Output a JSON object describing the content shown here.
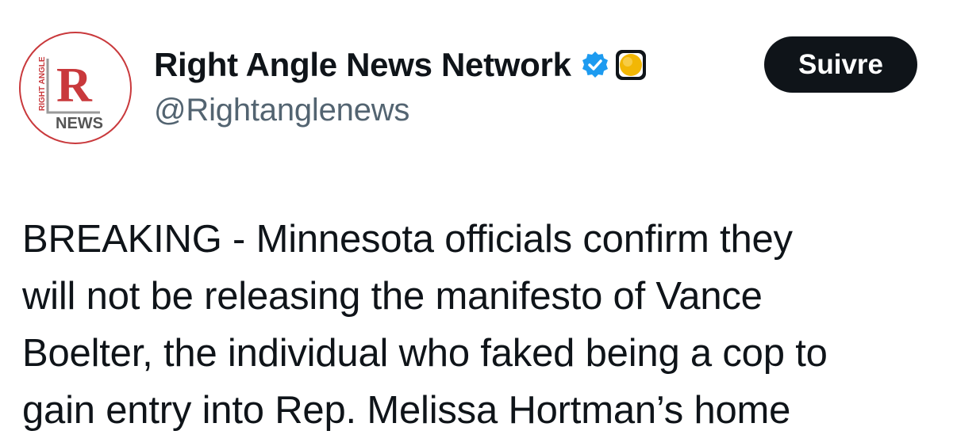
{
  "account": {
    "display_name": "Right Angle News Network",
    "handle": "@Rightanglenews",
    "avatar": {
      "logo_texts": [
        "RIGHT ANGLE",
        "R",
        "NEWS"
      ],
      "logo_color": "#c9393c"
    },
    "verified_badge": {
      "icon": "verified-badge-icon",
      "color": "#1d9bf0"
    },
    "affiliate_badge": {
      "icon": "affiliate-badge-icon",
      "color": "#f2b705"
    }
  },
  "follow_button": {
    "label": "Suivre",
    "background": "#0f1419",
    "text_color": "#ffffff"
  },
  "tweet": {
    "lines": [
      "BREAKING - Minnesota officials confirm they",
      "will not be releasing the manifesto of Vance",
      "Boelter, the individual who faked being a cop to",
      "gain entry into Rep. Melissa Hortman’s home"
    ]
  }
}
